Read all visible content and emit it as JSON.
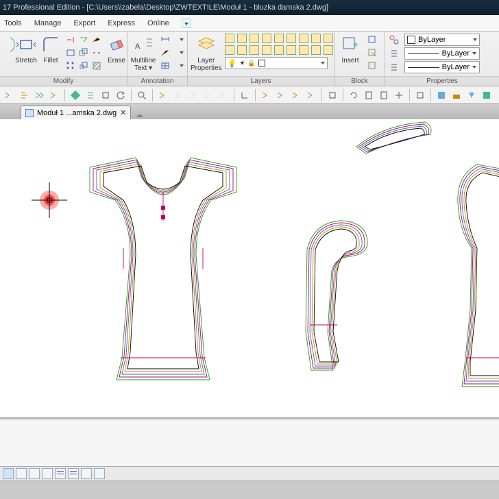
{
  "title": "17 Professional Edition - [C:\\Users\\izabela\\Desktop\\ZWTEXTILE\\Moduł 1 - bluzka damska 2.dwg]",
  "menu": {
    "tools": "Tools",
    "manage": "Manage",
    "export": "Export",
    "express": "Express",
    "online": "Online"
  },
  "ribbon": {
    "modify": {
      "stretch": "Stretch",
      "fillet": "Fillet",
      "erase": "Erase",
      "label": "Modify"
    },
    "annot": {
      "mtext": "Multiline\nText ▾",
      "label": "Annotation"
    },
    "layers": {
      "props": "Layer\nProperties",
      "label": "Layers"
    },
    "block": {
      "insert": "Insert",
      "label": "Block"
    },
    "props": {
      "bylayer_color": "ByLayer",
      "bylayer_line1": "ByLayer",
      "bylayer_line2": "ByLayer",
      "label": "Properties"
    }
  },
  "tab": {
    "name": "Moduł 1 ...amska 2.dwg"
  }
}
